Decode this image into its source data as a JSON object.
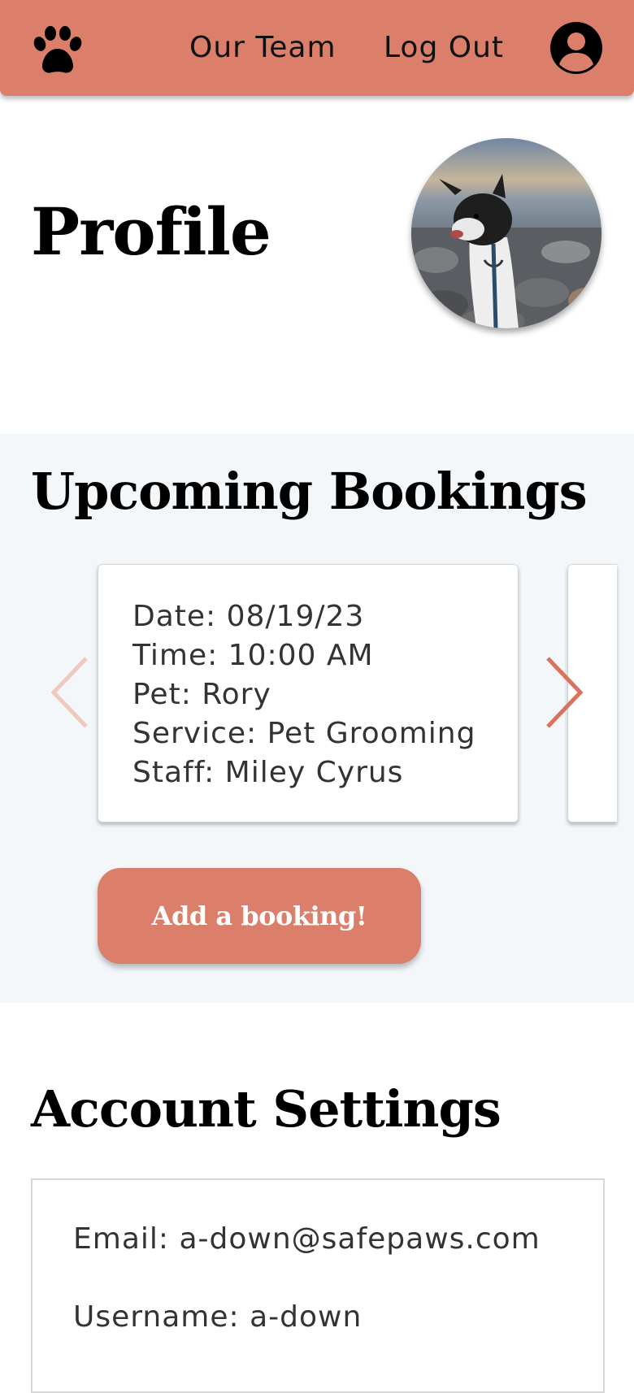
{
  "navbar": {
    "logo_icon": "paw-icon",
    "links": [
      "Our Team",
      "Log Out"
    ],
    "account_icon": "user-avatar-icon",
    "background_color": "#db7f6a"
  },
  "profile": {
    "title": "Profile",
    "photo": "dog-photo"
  },
  "bookings": {
    "title": "Upcoming Bookings",
    "prev_icon": "chevron-left-icon",
    "next_icon": "chevron-right-icon",
    "cards": [
      {
        "lines": [
          "Date: 08/19/23",
          "Time: 10:00 AM",
          "Pet: Rory",
          "Service: Pet Grooming",
          "Staff: Miley Cyrus"
        ]
      }
    ],
    "add_button": "Add a booking!"
  },
  "settings": {
    "title": "Account Settings",
    "email": "Email: a-down@safepaws.com",
    "username": "Username: a-down"
  }
}
